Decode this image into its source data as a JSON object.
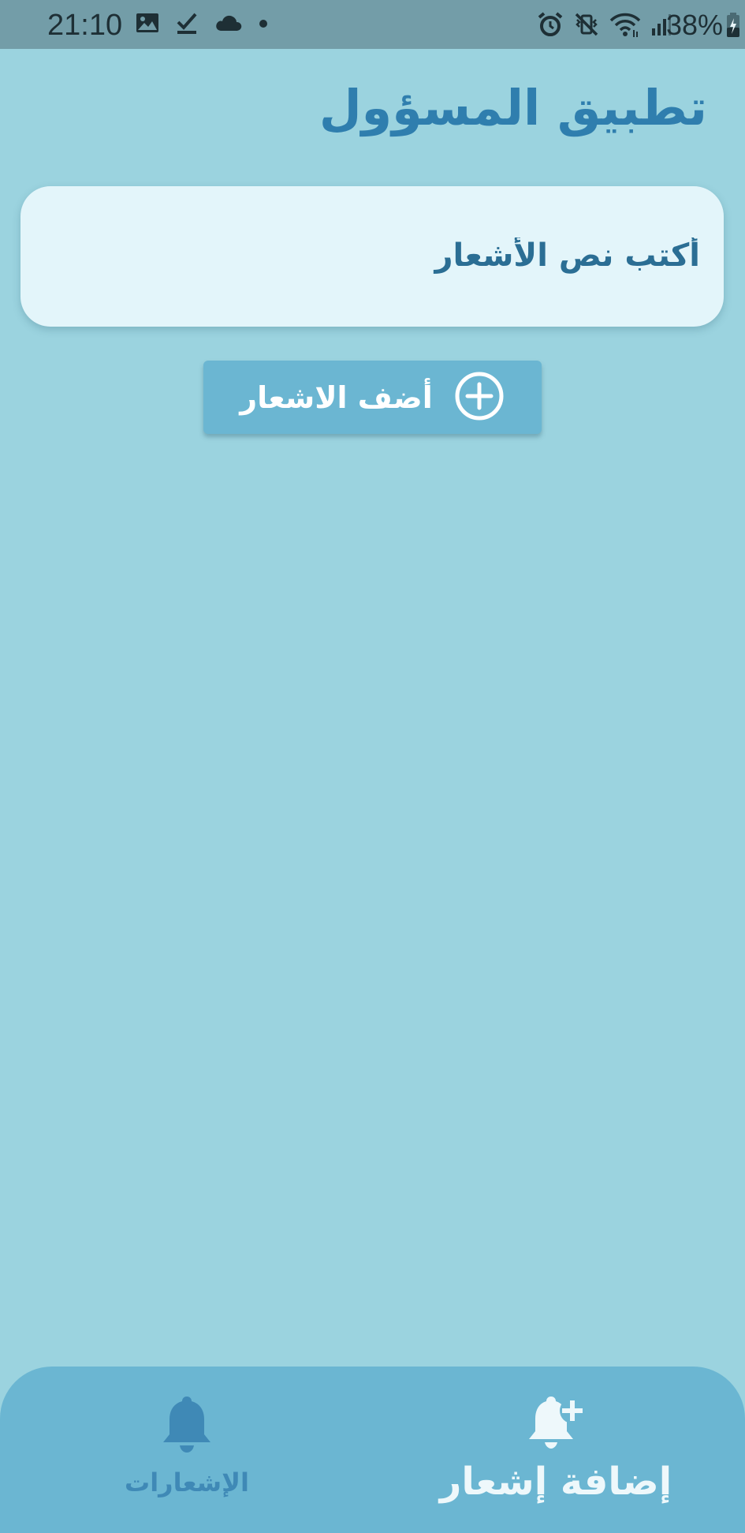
{
  "status_bar": {
    "time": "21:10",
    "battery_percent": "38%",
    "left_icons": [
      "image-icon",
      "check-download-icon",
      "cloud-icon",
      "dot-icon"
    ],
    "right_icons": [
      "alarm-icon",
      "vibrate-mute-icon",
      "wifi-icon",
      "signal-icon",
      "battery-charging-icon"
    ]
  },
  "app": {
    "title": "تطبيق المسؤول"
  },
  "notification_input": {
    "placeholder": "أكتب نص الأشعار",
    "value": ""
  },
  "add_button": {
    "label": "أضف الاشعار",
    "icon": "plus-circle-icon"
  },
  "bottom_nav": {
    "items": [
      {
        "label": "إضافة إشعار",
        "icon": "bell-plus-icon",
        "active": true
      },
      {
        "label": "الإشعارات",
        "icon": "bell-icon",
        "active": false
      }
    ]
  },
  "colors": {
    "background": "#9bd3df",
    "status_bar": "#739da8",
    "title": "#2f7eae",
    "card": "#e3f5fa",
    "button": "#6bb6d2",
    "nav_bar": "#6bb6d2",
    "nav_inactive": "#3f89b6",
    "nav_active": "#eef8fb"
  }
}
